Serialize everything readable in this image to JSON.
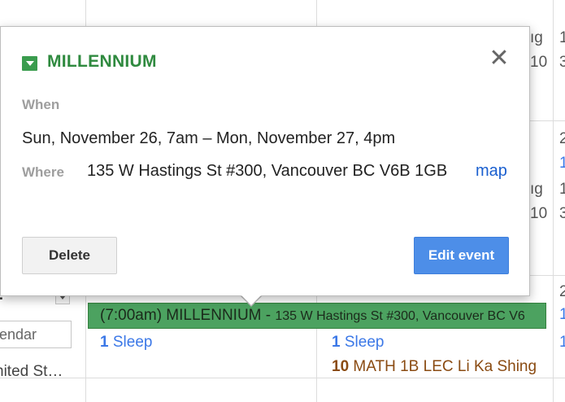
{
  "popup": {
    "title": "MILLENNIUM",
    "close_glyph": "✕",
    "when_label": "When",
    "when_value": "Sun, November 26, 7am – Mon, November 27, 4pm",
    "where_label": "Where",
    "where_value": "135 W Hastings St #300, Vancouver BC V6B 1GB",
    "map_link": "map",
    "delete_label": "Delete",
    "edit_label": "Edit event",
    "calendar_color": "#3a9c4e"
  },
  "background": {
    "right_col_top": [
      "ıg",
      "10"
    ],
    "right_col_mid": [
      "ıg",
      "10"
    ],
    "edge_col": [
      "1",
      "3",
      "2",
      "1",
      "1",
      "3",
      "2",
      "1",
      "1"
    ],
    "sidebar_input_placeholder": "lendar",
    "sidebar_country": "nited St…",
    "sidebar_mark": "?",
    "event_bar_time_title": "(7:00am) MILLENNIUM - ",
    "event_bar_location": "135 W Hastings St #300, Vancouver BC V6",
    "sleep_items": [
      {
        "count": "1",
        "label": "Sleep"
      },
      {
        "count": "1",
        "label": "Sleep"
      }
    ],
    "math_item": {
      "count": "10",
      "label": "MATH 1B LEC Li Ka Shing"
    }
  }
}
